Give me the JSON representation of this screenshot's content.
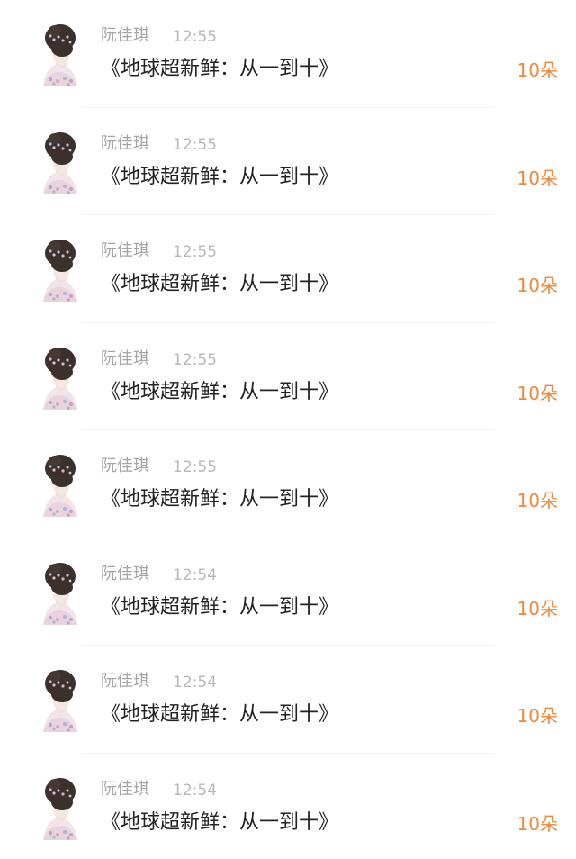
{
  "items": [
    {
      "name": "阮佳琪",
      "time": "12:55",
      "title": "《地球超新鲜：从一到十》",
      "amount": "10朵",
      "avatar": "avatar-girl-icon"
    },
    {
      "name": "阮佳琪",
      "time": "12:55",
      "title": "《地球超新鲜：从一到十》",
      "amount": "10朵",
      "avatar": "avatar-girl-icon"
    },
    {
      "name": "阮佳琪",
      "time": "12:55",
      "title": "《地球超新鲜：从一到十》",
      "amount": "10朵",
      "avatar": "avatar-girl-icon"
    },
    {
      "name": "阮佳琪",
      "time": "12:55",
      "title": "《地球超新鲜：从一到十》",
      "amount": "10朵",
      "avatar": "avatar-girl-icon"
    },
    {
      "name": "阮佳琪",
      "time": "12:55",
      "title": "《地球超新鲜：从一到十》",
      "amount": "10朵",
      "avatar": "avatar-girl-icon"
    },
    {
      "name": "阮佳琪",
      "time": "12:54",
      "title": "《地球超新鲜：从一到十》",
      "amount": "10朵",
      "avatar": "avatar-girl-icon"
    },
    {
      "name": "阮佳琪",
      "time": "12:54",
      "title": "《地球超新鲜：从一到十》",
      "amount": "10朵",
      "avatar": "avatar-girl-icon"
    },
    {
      "name": "阮佳琪",
      "time": "12:54",
      "title": "《地球超新鲜：从一到十》",
      "amount": "10朵",
      "avatar": "avatar-girl-icon"
    }
  ],
  "colors": {
    "accent": "#f0883a",
    "name": "#a6a6a6",
    "time": "#b8b8b8",
    "title": "#222222",
    "divider": "#f2f2f2"
  }
}
